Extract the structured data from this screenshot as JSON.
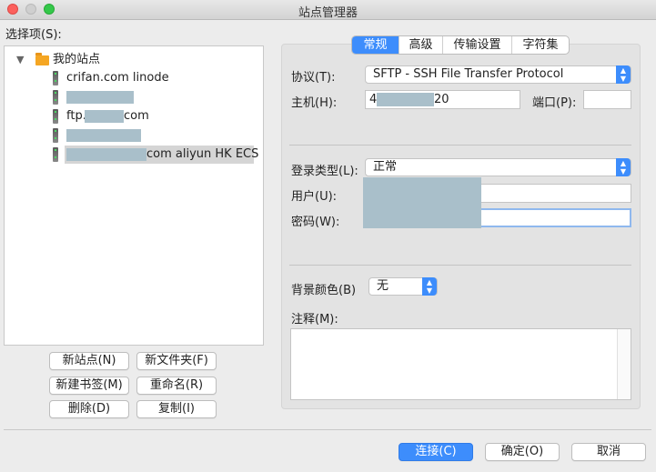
{
  "window": {
    "title": "站点管理器"
  },
  "left": {
    "select_label": "选择项(S):",
    "tree": {
      "root_label": "我的站点",
      "items": [
        {
          "label": "crifan.com linode"
        },
        {
          "label": ""
        },
        {
          "label_prefix": "ftp.",
          "label_suffix": "com"
        },
        {
          "label": ""
        },
        {
          "label": "com aliyun HK ECS",
          "selected": true
        }
      ]
    },
    "buttons": {
      "new_site": "新站点(N)",
      "new_folder": "新文件夹(F)",
      "new_bookmark": "新建书签(M)",
      "rename": "重命名(R)",
      "delete": "删除(D)",
      "copy": "复制(I)"
    }
  },
  "tabs": [
    {
      "label": "常规",
      "active": true
    },
    {
      "label": "高级",
      "active": false
    },
    {
      "label": "传输设置",
      "active": false
    },
    {
      "label": "字符集",
      "active": false
    }
  ],
  "general": {
    "protocol_label": "协议(T):",
    "protocol_value": "SFTP - SSH File Transfer Protocol",
    "host_label": "主机(H):",
    "host_value_prefix": "4",
    "host_value_suffix": "20",
    "port_label": "端口(P):",
    "port_value": "",
    "login_type_label": "登录类型(L):",
    "login_type_value": "正常",
    "user_label": "用户(U):",
    "password_label": "密码(W):",
    "bg_color_label": "背景颜色(B)",
    "bg_color_value": "无",
    "comments_label": "注释(M):"
  },
  "footer": {
    "connect": "连接(C)",
    "ok": "确定(O)",
    "cancel": "取消"
  },
  "colors": {
    "accent": "#3d8dfc",
    "redaction": "#a9bfca"
  }
}
